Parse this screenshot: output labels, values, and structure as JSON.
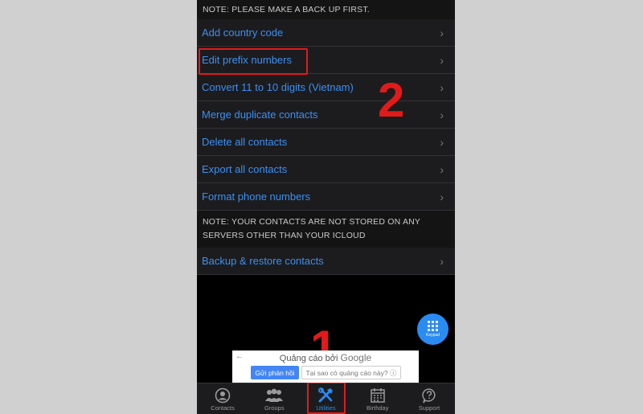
{
  "note_top": "NOTE: PLEASE MAKE A BACK UP FIRST.",
  "menu": [
    {
      "label": "Add country code"
    },
    {
      "label": "Edit prefix numbers"
    },
    {
      "label": "Convert 11 to 10 digits (Vietnam)"
    },
    {
      "label": "Merge duplicate contacts"
    },
    {
      "label": "Delete all contacts"
    },
    {
      "label": "Export all contacts"
    },
    {
      "label": "Format phone numbers"
    }
  ],
  "note_mid": "NOTE: YOUR CONTACTS ARE NOT STORED ON ANY SERVERS OTHER THAN YOUR ICLOUD",
  "backup_label": "Backup & restore contacts",
  "chevron": "›",
  "annotations": {
    "step1": "1",
    "step2": "2"
  },
  "keypad_label": "Keypad",
  "ad": {
    "back": "←",
    "title_prefix": "Quảng cáo bởi",
    "google": "Google",
    "feedback_button": "Gửi phản hồi",
    "why_button": "Tại sao có quảng cáo này? ⓘ"
  },
  "tabs": [
    {
      "label": "Contacts",
      "icon": "contact-icon"
    },
    {
      "label": "Groups",
      "icon": "groups-icon"
    },
    {
      "label": "Utilities",
      "icon": "tools-icon",
      "active": true
    },
    {
      "label": "Birthday",
      "icon": "calendar-icon"
    },
    {
      "label": "Support",
      "icon": "support-icon"
    }
  ],
  "colors": {
    "accent": "#2a8bf2",
    "highlight": "#e21a1a",
    "link": "#3b8ff3"
  }
}
